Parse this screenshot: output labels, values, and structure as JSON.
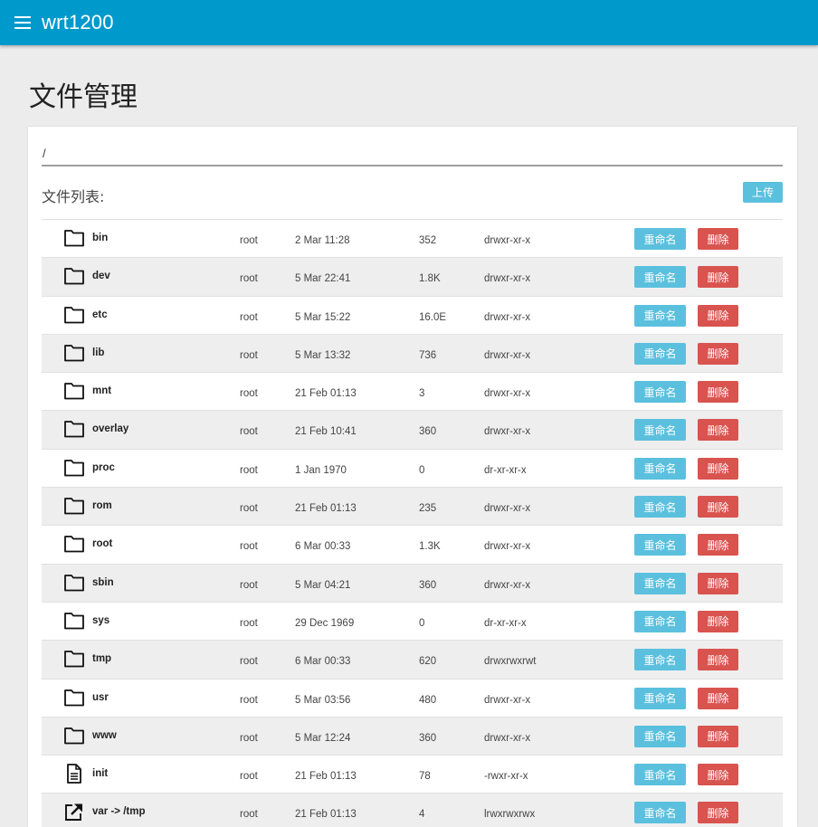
{
  "header": {
    "title": "wrt1200",
    "menu_icon": "menu-icon",
    "background_color": "#0099cc"
  },
  "page": {
    "title": "文件管理"
  },
  "path_input": {
    "value": "/"
  },
  "file_list": {
    "label": "文件列表:",
    "upload_label": "上传",
    "rename_label": "重命名",
    "delete_label": "删除",
    "rename_color": "#5bc0de",
    "delete_color": "#d9534f",
    "rows": [
      {
        "icon": "folder-icon",
        "name": "bin",
        "owner": "root",
        "date": "2 Mar 11:28",
        "size": "352",
        "perm": "drwxr-xr-x"
      },
      {
        "icon": "folder-icon",
        "name": "dev",
        "owner": "root",
        "date": "5 Mar 22:41",
        "size": "1.8K",
        "perm": "drwxr-xr-x"
      },
      {
        "icon": "folder-icon",
        "name": "etc",
        "owner": "root",
        "date": "5 Mar 15:22",
        "size": "16.0E",
        "perm": "drwxr-xr-x"
      },
      {
        "icon": "folder-icon",
        "name": "lib",
        "owner": "root",
        "date": "5 Mar 13:32",
        "size": "736",
        "perm": "drwxr-xr-x"
      },
      {
        "icon": "folder-icon",
        "name": "mnt",
        "owner": "root",
        "date": "21 Feb 01:13",
        "size": "3",
        "perm": "drwxr-xr-x"
      },
      {
        "icon": "folder-icon",
        "name": "overlay",
        "owner": "root",
        "date": "21 Feb 10:41",
        "size": "360",
        "perm": "drwxr-xr-x"
      },
      {
        "icon": "folder-icon",
        "name": "proc",
        "owner": "root",
        "date": "1 Jan 1970",
        "size": "0",
        "perm": "dr-xr-xr-x"
      },
      {
        "icon": "folder-icon",
        "name": "rom",
        "owner": "root",
        "date": "21 Feb 01:13",
        "size": "235",
        "perm": "drwxr-xr-x"
      },
      {
        "icon": "folder-icon",
        "name": "root",
        "owner": "root",
        "date": "6 Mar 00:33",
        "size": "1.3K",
        "perm": "drwxr-xr-x"
      },
      {
        "icon": "folder-icon",
        "name": "sbin",
        "owner": "root",
        "date": "5 Mar 04:21",
        "size": "360",
        "perm": "drwxr-xr-x"
      },
      {
        "icon": "folder-icon",
        "name": "sys",
        "owner": "root",
        "date": "29 Dec 1969",
        "size": "0",
        "perm": "dr-xr-xr-x"
      },
      {
        "icon": "folder-icon",
        "name": "tmp",
        "owner": "root",
        "date": "6 Mar 00:33",
        "size": "620",
        "perm": "drwxrwxrwt"
      },
      {
        "icon": "folder-icon",
        "name": "usr",
        "owner": "root",
        "date": "5 Mar 03:56",
        "size": "480",
        "perm": "drwxr-xr-x"
      },
      {
        "icon": "folder-icon",
        "name": "www",
        "owner": "root",
        "date": "5 Mar 12:24",
        "size": "360",
        "perm": "drwxr-xr-x"
      },
      {
        "icon": "file-icon",
        "name": "init",
        "owner": "root",
        "date": "21 Feb 01:13",
        "size": "78",
        "perm": "-rwxr-xr-x"
      },
      {
        "icon": "link-icon",
        "name": "var -> /tmp",
        "owner": "root",
        "date": "21 Feb 01:13",
        "size": "4",
        "perm": "lrwxrwxrwx"
      }
    ]
  }
}
